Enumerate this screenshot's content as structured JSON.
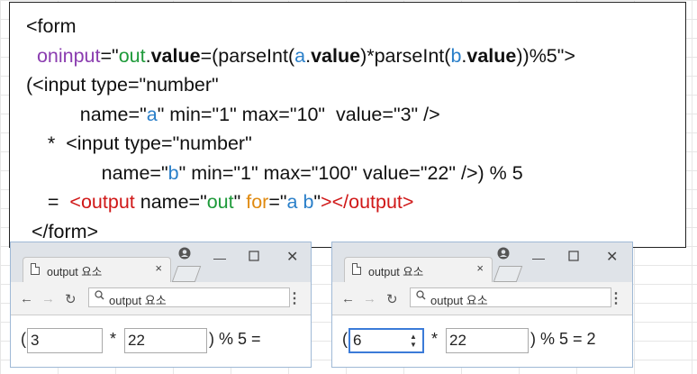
{
  "code": {
    "line1": "<form",
    "line2": {
      "attr": "oninput",
      "eq": "=\"",
      "out": "out",
      "dot1": ".",
      "value1": "value",
      "mid1": "=(parseInt(",
      "a": "a",
      "dot2": ".",
      "value2": "value",
      "mid2": ")*parseInt(",
      "b": "b",
      "dot3": ".",
      "value3": "value",
      "end": "))%5\">"
    },
    "line3": "(<input type=\"number\"",
    "line4": {
      "pre": "name=\"",
      "a": "a",
      "post": "\" min=\"1\" max=\"10\"  value=\"3\" />"
    },
    "line5": "*  <input type=\"number\"",
    "line6": {
      "pre": "name=\"",
      "b": "b",
      "post": "\" min=\"1\" max=\"100\" value=\"22\" />) % 5"
    },
    "line7": {
      "pre": "=  ",
      "tag": "<output",
      "mid1": " name=\"",
      "out": "out",
      "mid2": "\" ",
      "for": "for",
      "mid3": "=\"",
      "ab": "a b",
      "mid4": "\"",
      "close": "></output>"
    },
    "line8": "</form>"
  },
  "windows": [
    {
      "tab_title": "output 요소",
      "tab_close": "×",
      "address": "output 요소",
      "open_paren": "(",
      "input_a_value": "3",
      "times": "*",
      "input_b_value": "22",
      "suffix": ") % 5 =",
      "result": ""
    },
    {
      "tab_title": "output 요소",
      "tab_close": "×",
      "address": "output 요소",
      "open_paren": "(",
      "input_a_value": "6",
      "times": "*",
      "input_b_value": "22",
      "suffix": ") % 5 = 2",
      "result": "2"
    }
  ],
  "icons": {
    "back": "arrow-left-icon",
    "forward": "arrow-right-icon",
    "reload": "reload-icon",
    "search": "search-icon",
    "menu": "kebab-menu-icon",
    "account": "account-icon",
    "minimize": "minimize-icon",
    "maximize": "maximize-icon",
    "close": "close-icon",
    "document": "document-icon"
  },
  "colors": {
    "attr": "#8b3db0",
    "string_value": "#1e9a3a",
    "identifier": "#2a7fc9",
    "tag": "#d01818",
    "for_attr": "#e08a10",
    "focus_border": "#3b7bd8"
  }
}
